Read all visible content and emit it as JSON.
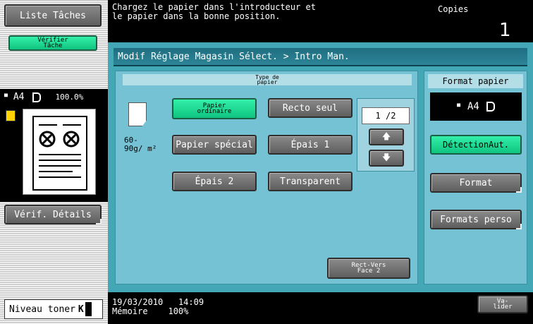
{
  "left": {
    "job_list_label": "Liste Tâches",
    "verify_job_label": "Vérifier Tâche",
    "paper_size": "A4",
    "zoom": "100.0%",
    "verify_details_label": "Vérif. Détails",
    "toner_label": "Niveau toner",
    "toner_color": "K"
  },
  "header": {
    "message_line1": "Chargez le papier dans l'introducteur et",
    "message_line2": "le papier dans la bonne position.",
    "copies_label": "Copies",
    "copies_value": "1"
  },
  "breadcrumb": "Modif Réglage Magasin Sélect. > Intro Man.",
  "paper_type": {
    "title_line1": "Type de",
    "title_line2": "papier",
    "weight_line1": "60-",
    "weight_line2": "90g/ m²",
    "buttons": {
      "plain_line1": "Papier",
      "plain_line2": "ordinaire",
      "single_side": "Recto seul",
      "special": "Papier spécial",
      "thick1": "Épais 1",
      "thick2": "Épais 2",
      "transparent": "Transparent"
    },
    "page_indicator": "1 /2",
    "rect_verso_line1": "Rect-Vers",
    "rect_verso_line2": "Face 2"
  },
  "paper_format": {
    "title": "Format papier",
    "current": "A4",
    "auto_detect": "DétectionAut.",
    "format": "Format",
    "custom_formats": "Formats perso"
  },
  "footer": {
    "date": "19/03/2010",
    "time": "14:09",
    "memory_label": "Mémoire",
    "memory_value": "100%",
    "validate_line1": "Va-",
    "validate_line2": "lider"
  },
  "colors": {
    "accent_green": "#19d88f",
    "panel_teal": "#44a7b6",
    "panel_light": "#74c2d4"
  }
}
